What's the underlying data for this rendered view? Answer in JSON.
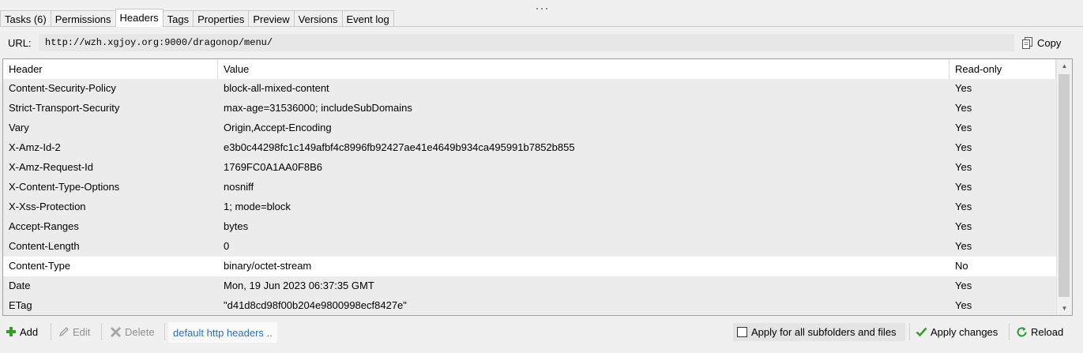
{
  "tabs": [
    {
      "label": "Tasks (6)"
    },
    {
      "label": "Permissions"
    },
    {
      "label": "Headers",
      "active": true
    },
    {
      "label": "Tags"
    },
    {
      "label": "Properties"
    },
    {
      "label": "Preview"
    },
    {
      "label": "Versions"
    },
    {
      "label": "Event log"
    }
  ],
  "url": {
    "label": "URL:",
    "value": "http://wzh.xgjoy.org:9000/dragonop/menu/",
    "copy_label": "Copy"
  },
  "table": {
    "columns": [
      "Header",
      "Value",
      "Read-only"
    ],
    "rows": [
      {
        "header": "Content-Security-Policy",
        "value": "block-all-mixed-content",
        "readonly": "Yes"
      },
      {
        "header": "Strict-Transport-Security",
        "value": "max-age=31536000; includeSubDomains",
        "readonly": "Yes"
      },
      {
        "header": "Vary",
        "value": "Origin,Accept-Encoding",
        "readonly": "Yes"
      },
      {
        "header": "X-Amz-Id-2",
        "value": "e3b0c44298fc1c149afbf4c8996fb92427ae41e4649b934ca495991b7852b855",
        "readonly": "Yes"
      },
      {
        "header": "X-Amz-Request-Id",
        "value": "1769FC0A1AA0F8B6",
        "readonly": "Yes"
      },
      {
        "header": "X-Content-Type-Options",
        "value": "nosniff",
        "readonly": "Yes"
      },
      {
        "header": "X-Xss-Protection",
        "value": "1; mode=block",
        "readonly": "Yes"
      },
      {
        "header": "Accept-Ranges",
        "value": "bytes",
        "readonly": "Yes"
      },
      {
        "header": "Content-Length",
        "value": "0",
        "readonly": "Yes"
      },
      {
        "header": "Content-Type",
        "value": "binary/octet-stream",
        "readonly": "No",
        "selected": true
      },
      {
        "header": "Date",
        "value": "Mon, 19 Jun 2023 06:37:35 GMT",
        "readonly": "Yes"
      },
      {
        "header": "ETag",
        "value": "\"d41d8cd98f00b204e9800998ecf8427e\"",
        "readonly": "Yes"
      }
    ]
  },
  "toolbar": {
    "add_label": "Add",
    "edit_label": "Edit",
    "delete_label": "Delete",
    "default_link": "default http headers ..",
    "apply_all_label": "Apply for all subfolders and files",
    "apply_all_checked": false,
    "apply_changes_label": "Apply changes",
    "reload_label": "Reload"
  },
  "colors": {
    "link": "#2d6fb9",
    "add_green": "#3a9a2b",
    "reload_green": "#2f9a3b"
  }
}
